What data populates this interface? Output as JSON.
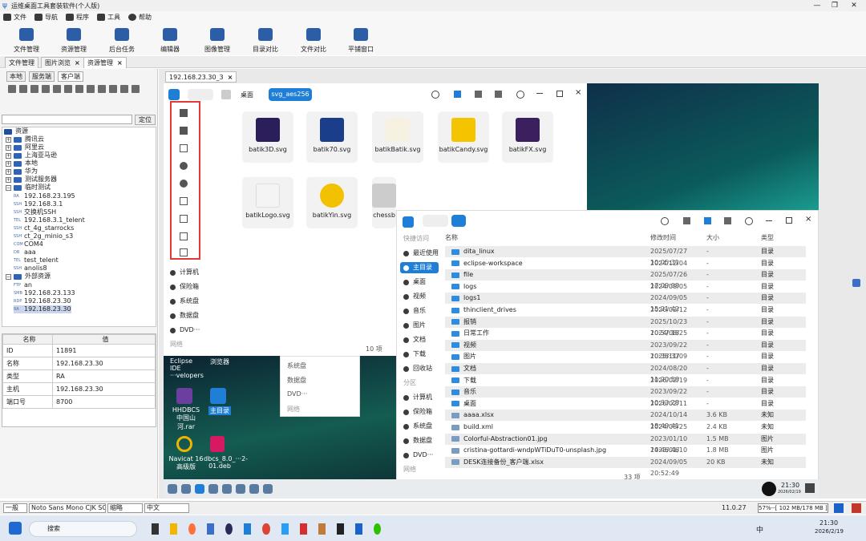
{
  "window": {
    "title": "运维桌面工具套装软件(个人版)",
    "controls": [
      "—",
      "❐",
      "✕"
    ]
  },
  "menu": [
    {
      "label": "文件"
    },
    {
      "label": "导航"
    },
    {
      "label": "程序"
    },
    {
      "label": "工具"
    },
    {
      "label": "帮助"
    }
  ],
  "toolbar": [
    {
      "label": "文件管理",
      "icon": "folder-open-icon"
    },
    {
      "label": "资源管理",
      "icon": "resource-icon"
    },
    {
      "label": "后台任务",
      "icon": "monitor-icon"
    },
    {
      "label": "编辑器",
      "icon": "edit-icon"
    },
    {
      "label": "图像管理",
      "icon": "image-icon"
    },
    {
      "label": "目录对比",
      "icon": "compare-icon"
    },
    {
      "label": "文件对比",
      "icon": "file-compare-icon"
    },
    {
      "label": "平铺窗口",
      "icon": "tile-window-icon"
    }
  ],
  "doc_tabs": [
    {
      "label": "文件管理",
      "closable": false
    },
    {
      "label": "图片浏览",
      "closable": true
    },
    {
      "label": "资源管理",
      "closable": true,
      "active": true
    }
  ],
  "left_tabs": [
    "本地",
    "服务端",
    "客户端"
  ],
  "locate_button": "定位",
  "tree": [
    {
      "label": "资源",
      "type": "root"
    },
    {
      "label": "腾讯云",
      "type": "folder"
    },
    {
      "label": "阿里云",
      "type": "folder"
    },
    {
      "label": "上海亚马逊",
      "type": "folder"
    },
    {
      "label": "本地",
      "type": "folder"
    },
    {
      "label": "华为",
      "type": "folder"
    },
    {
      "label": "测试服务器",
      "type": "folder"
    },
    {
      "label": "临时测试",
      "type": "folder"
    },
    {
      "label": "192.168.23.195",
      "tag": "RA"
    },
    {
      "label": "192.168.3.1",
      "tag": "SSH"
    },
    {
      "label": "交换机SSH",
      "tag": "SSH"
    },
    {
      "label": "192.168.3.1_telent",
      "tag": "TEL"
    },
    {
      "label": "ct_4g_starrocks",
      "tag": "SSH"
    },
    {
      "label": "ct_2g_minio_s3",
      "tag": "SSH"
    },
    {
      "label": "COM4",
      "tag": "COM"
    },
    {
      "label": "aaa",
      "tag": "DB"
    },
    {
      "label": "test_telent",
      "tag": "TEL"
    },
    {
      "label": "anolis8",
      "tag": "SSH"
    },
    {
      "label": "外部资源",
      "type": "folder"
    },
    {
      "label": "an",
      "tag": "FTP"
    },
    {
      "label": "192.168.23.133",
      "tag": "SMB"
    },
    {
      "label": "192.168.23.30",
      "tag": "RDP"
    },
    {
      "label": "192.168.23.30",
      "tag": "RA",
      "selected": true
    }
  ],
  "props": {
    "headers": [
      "名称",
      "值"
    ],
    "rows": [
      [
        "ID",
        "11891"
      ],
      [
        "名称",
        "192.168.23.30"
      ],
      [
        "类型",
        "RA"
      ],
      [
        "主机",
        "192.168.23.30"
      ],
      [
        "端口号",
        "8700"
      ]
    ]
  },
  "session_tab": "192.168.23.30_3",
  "fm1": {
    "breadcrumb": [
      "桌面",
      "svg_aes256"
    ],
    "items": [
      "batik3D.svg",
      "batik70.svg",
      "batikBatik.svg",
      "batikCandy.svg",
      "batikFX.svg",
      "batikLogo.svg",
      "batikYin.svg",
      "chessb"
    ],
    "side": [
      "计算机",
      "保险箱",
      "系统盘",
      "数据盘",
      "DVD···",
      "网络"
    ],
    "count": "10 项",
    "float": [
      "系统盘",
      "数据盘",
      "DVD···",
      "网络"
    ]
  },
  "desktop_icons": [
    "Eclipse IDE ···velopers",
    "浏览器",
    "HHDBCS 中国山河.rar",
    "主目录",
    "Navicat 16 高级版",
    "dbcs_8.0_···2-01.deb"
  ],
  "fm2": {
    "side_title": "快捷访问",
    "side": [
      "最近使用",
      "主目录",
      "桌面",
      "视频",
      "音乐",
      "图片",
      "文档",
      "下载",
      "回收站"
    ],
    "side2_title": "分区",
    "side2": [
      "计算机",
      "保险箱",
      "系统盘",
      "数据盘",
      "DVD···",
      "网络"
    ],
    "columns": [
      "名称",
      "修改时间",
      "大小",
      "类型"
    ],
    "rows": [
      [
        "dita_linux",
        "2025/07/27 10:05:31",
        "-",
        "目录"
      ],
      [
        "eclipse-workspace",
        "2024/12/04 10:56:09",
        "-",
        "目录"
      ],
      [
        "file",
        "2025/07/26 17:09:08",
        "-",
        "目录"
      ],
      [
        "logs",
        "2024/09/05 16:19:26",
        "-",
        "目录"
      ],
      [
        "logs1",
        "2024/09/05 15:21:42",
        "-",
        "目录"
      ],
      [
        "thinclient_drives",
        "2026/02/12 09:26:10",
        "-",
        "目录"
      ],
      [
        "报销",
        "2025/10/23 10:57:18",
        "-",
        "目录"
      ],
      [
        "日常工作",
        "2024/08/25 15:31:07",
        "-",
        "目录"
      ],
      [
        "视频",
        "2023/09/22 10:38:37",
        "-",
        "目录"
      ],
      [
        "图片",
        "2025/11/09 16:47:31",
        "-",
        "目录"
      ],
      [
        "文档",
        "2024/08/20 11:20:58",
        "-",
        "目录"
      ],
      [
        "下载",
        "2026/02/19 16:52:04",
        "-",
        "目录"
      ],
      [
        "音乐",
        "2023/09/22 10:33:28",
        "-",
        "目录"
      ],
      [
        "桌面",
        "2026/02/11 12:52:05",
        "-",
        "目录"
      ],
      [
        "aaaa.xlsx",
        "2024/10/14 18:49:41",
        "3.6 KB",
        "未知"
      ],
      [
        "build.xml",
        "2024/08/25 16:32:20",
        "2.4 KB",
        "未知"
      ],
      [
        "Colorful-Abstraction01.jpg",
        "2023/01/10 14:46:46",
        "1.5 MB",
        "图片"
      ],
      [
        "cristina-gottardi-wndpWTiDuT0-unsplash.jpg",
        "2023/01/10 14:46:46",
        "1.8 MB",
        "图片"
      ],
      [
        "DESK连接备份_客户端.xlsx",
        "2024/09/05 20:52:49",
        "20 KB",
        "未知"
      ]
    ],
    "count": "33 项"
  },
  "remote_clock": {
    "time": "21:30",
    "date": "2026/02/19"
  },
  "status": {
    "mode": "一般",
    "font": "Noto Sans Mono CJK SC",
    "encoding": "缩略",
    "lang": "中文",
    "version": "11.0.27",
    "memory": "57%--[ 102 MB/178 MB ]"
  },
  "win": {
    "search": "搜索",
    "ime": "中",
    "time": "21:30",
    "date": "2026/2/19"
  },
  "accent": "#1f7fd6",
  "highlight": "#e53935"
}
